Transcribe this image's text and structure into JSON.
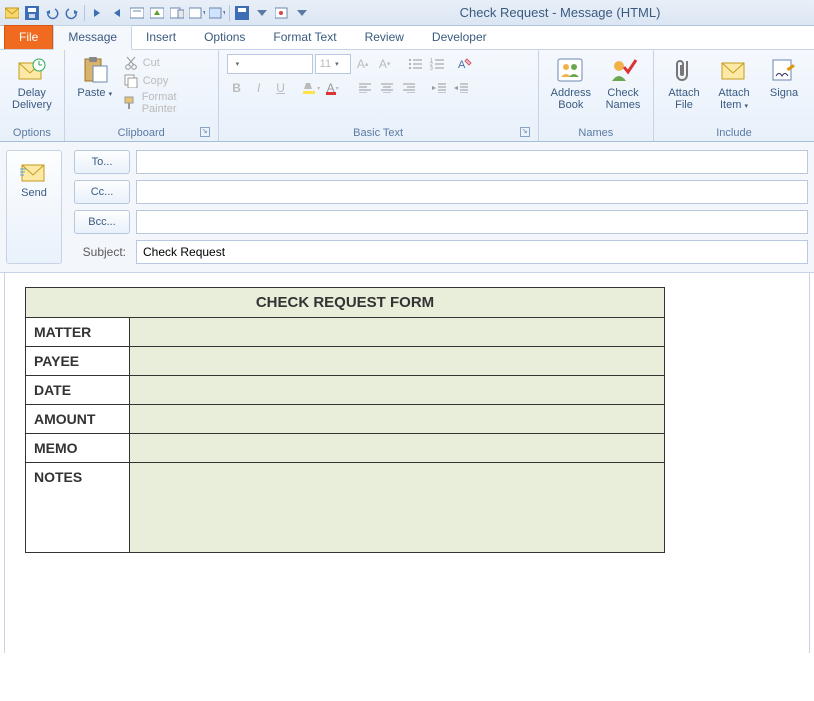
{
  "window_title": "Check Request - Message (HTML)",
  "tabs": {
    "file": "File",
    "message": "Message",
    "insert": "Insert",
    "options": "Options",
    "format": "Format Text",
    "review": "Review",
    "developer": "Developer"
  },
  "ribbon": {
    "options_group": "Options",
    "delay": "Delay\nDelivery",
    "clipboard_group": "Clipboard",
    "paste": "Paste",
    "cut": "Cut",
    "copy": "Copy",
    "format_painter": "Format Painter",
    "basic_text_group": "Basic Text",
    "font_size": "11",
    "names_group": "Names",
    "address_book": "Address\nBook",
    "check_names": "Check\nNames",
    "include_group": "Include",
    "attach_file": "Attach\nFile",
    "attach_item": "Attach\nItem",
    "signature": "Signa"
  },
  "header": {
    "send": "Send",
    "to": "To...",
    "cc": "Cc...",
    "bcc": "Bcc...",
    "to_val": "",
    "cc_val": "",
    "bcc_val": "",
    "subject_label": "Subject:",
    "subject_val": "Check Request"
  },
  "form": {
    "title": "CHECK REQUEST FORM",
    "rows": [
      {
        "label": "MATTER",
        "value": ""
      },
      {
        "label": "PAYEE",
        "value": ""
      },
      {
        "label": "DATE",
        "value": ""
      },
      {
        "label": "AMOUNT",
        "value": ""
      },
      {
        "label": "MEMO",
        "value": ""
      },
      {
        "label": "NOTES",
        "value": ""
      }
    ]
  }
}
